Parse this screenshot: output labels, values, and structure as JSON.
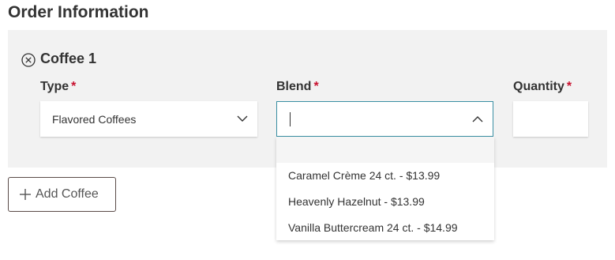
{
  "page": {
    "title": "Order Information"
  },
  "item": {
    "title": "Coffee 1",
    "type": {
      "label": "Type",
      "required_mark": "*",
      "value": "Flavored Coffees"
    },
    "blend": {
      "label": "Blend",
      "required_mark": "*",
      "value": "",
      "options": [
        "Caramel Crème 24 ct. - $13.99",
        "Heavenly Hazelnut - $13.99",
        "Vanilla Buttercream 24 ct. - $14.99"
      ]
    },
    "quantity": {
      "label": "Quantity",
      "required_mark": "*",
      "value": ""
    }
  },
  "actions": {
    "add_label": "Add Coffee"
  },
  "colors": {
    "required": "#c8102e",
    "focus_border": "#3a8fa3",
    "panel_bg": "#f2f2f2"
  },
  "icons": {
    "remove": "close-circle-icon",
    "type_toggle": "chevron-down-icon",
    "blend_toggle": "chevron-up-icon",
    "add": "plus-icon"
  }
}
